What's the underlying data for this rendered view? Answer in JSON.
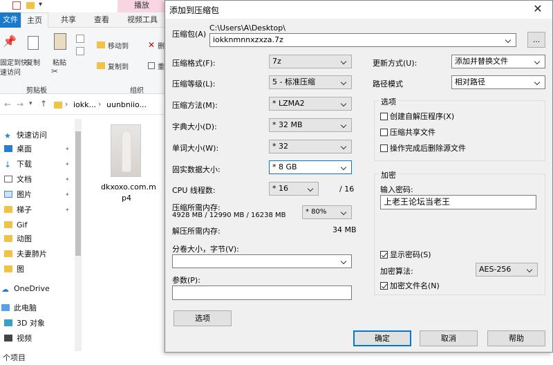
{
  "explorer": {
    "tabs": {
      "file": "文件",
      "home": "主页",
      "share": "共享",
      "view": "查看",
      "video_tools": "视频工具",
      "play": "播放"
    },
    "ribbon": {
      "pin_label_line1": "固定到快",
      "pin_label_line2": "速访问",
      "copy": "复制",
      "paste": "粘贴",
      "move_to": "移动到",
      "copy_to": "复制到",
      "delete_partial": "删",
      "rename_partial": "重",
      "clipboard_group": "剪贴板",
      "organize_group": "组织"
    },
    "address": {
      "seg1": "iokk...",
      "seg2": "uunbniio..."
    },
    "nav": [
      {
        "label": "快速访问",
        "pinned": false
      },
      {
        "label": "桌面",
        "pinned": true
      },
      {
        "label": "下载",
        "pinned": true
      },
      {
        "label": "文档",
        "pinned": true
      },
      {
        "label": "图片",
        "pinned": true
      },
      {
        "label": "梯子",
        "pinned": true
      },
      {
        "label": "Gif",
        "pinned": false
      },
      {
        "label": "动图",
        "pinned": false
      },
      {
        "label": "夫妻肺片",
        "pinned": false
      },
      {
        "label": "图",
        "pinned": false
      },
      {
        "label": "OneDrive",
        "pinned": false
      },
      {
        "label": "此电脑",
        "pinned": false
      },
      {
        "label": "3D 对象",
        "pinned": false
      },
      {
        "label": "视频",
        "pinned": false
      }
    ],
    "file": {
      "name_line1": "dkxoxo.com.m",
      "name_line2": "p4"
    },
    "status": "个项目"
  },
  "dialog": {
    "title": "添加到压缩包",
    "archive_label": "压缩包(A)",
    "archive_path": "C:\\Users\\A\\Desktop\\",
    "archive_name": "iokknmnnxzxza.7z",
    "browse_button": "...",
    "format_label": "压缩格式(F):",
    "format_value": "7z",
    "level_label": "压缩等级(L):",
    "level_value": "5 - 标准压缩",
    "method_label": "压缩方法(M):",
    "method_value": "* LZMA2",
    "dict_label": "字典大小(D):",
    "dict_value": "* 32 MB",
    "word_label": "单词大小(W):",
    "word_value": "* 32",
    "solid_label": "固实数据大小:",
    "solid_value": "* 8 GB",
    "threads_label": "CPU 线程数:",
    "threads_value": "* 16",
    "threads_total": "/ 16",
    "mem_comp_label": "压缩所需内存:",
    "mem_comp_value": "4928 MB / 12990 MB / 16238 MB",
    "mem_percent": "* 80%",
    "mem_decomp_label": "解压所需内存:",
    "mem_decomp_value": "34 MB",
    "split_label": "分卷大小，字节(V):",
    "params_label": "参数(P):",
    "options_button": "选项",
    "update_label": "更新方式(U):",
    "update_value": "添加并替换文件",
    "path_label": "路径模式",
    "path_value": "相对路径",
    "options_group": "选项",
    "opt_sfx": "创建自解压程序(X)",
    "opt_shared": "压缩共享文件",
    "opt_delete": "操作完成后删除源文件",
    "encrypt_group": "加密",
    "password_label": "输入密码:",
    "password_value": "上老王论坛当老王",
    "show_password": "显示密码(S)",
    "enc_method_label": "加密算法:",
    "enc_method_value": "AES-256",
    "encrypt_names": "加密文件名(N)",
    "ok_button": "确定",
    "cancel_button": "取消",
    "help_button": "帮助"
  }
}
